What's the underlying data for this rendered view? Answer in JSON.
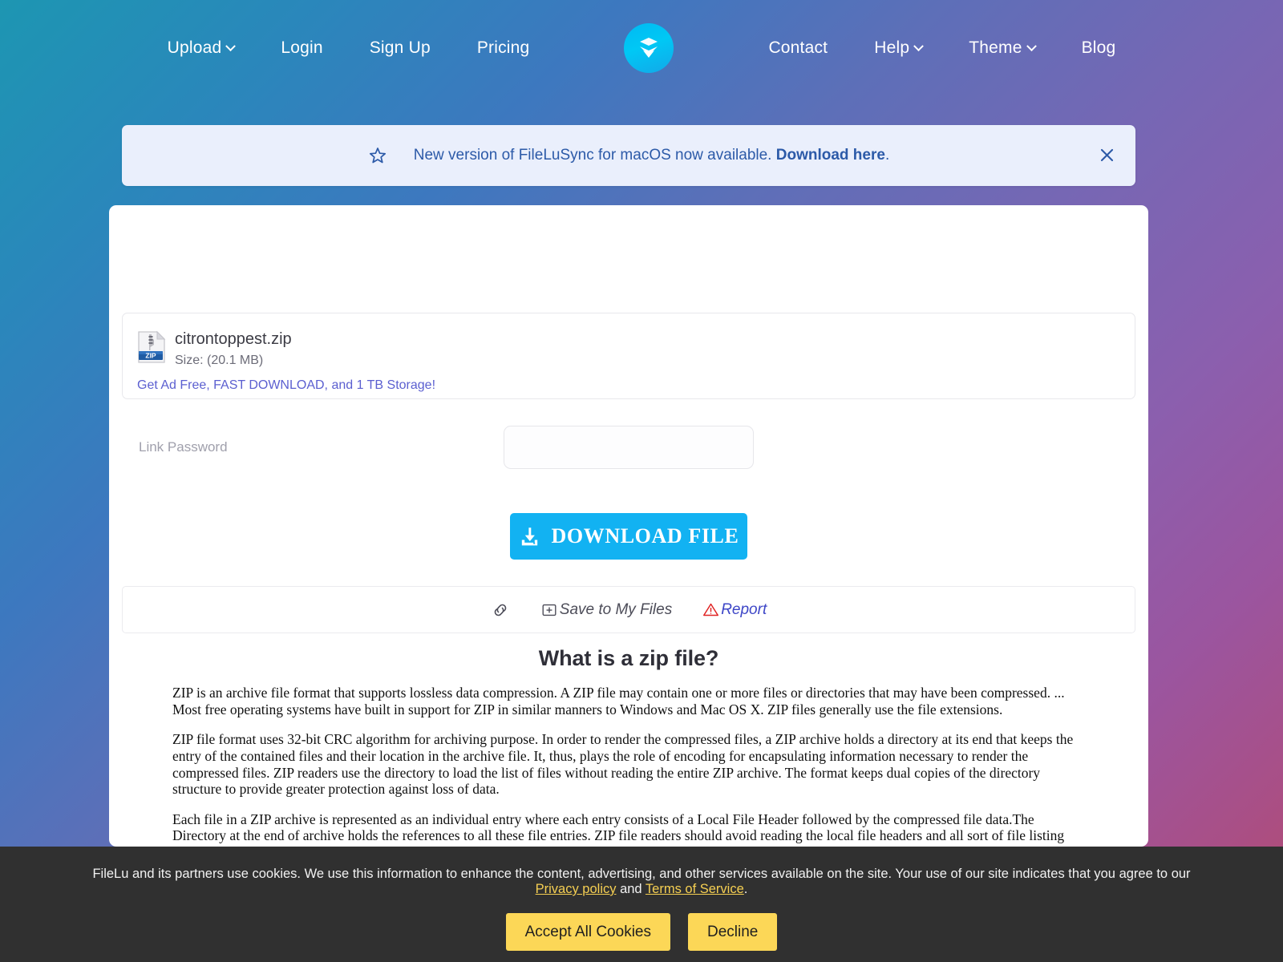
{
  "nav": {
    "left_items": [
      {
        "label": "Upload",
        "has_caret": true
      },
      {
        "label": "Login",
        "has_caret": false
      },
      {
        "label": "Sign Up",
        "has_caret": false
      },
      {
        "label": "Pricing",
        "has_caret": false
      }
    ],
    "right_items": [
      {
        "label": "Contact",
        "has_caret": false
      },
      {
        "label": "Help",
        "has_caret": true
      },
      {
        "label": "Theme",
        "has_caret": true
      },
      {
        "label": "Blog",
        "has_caret": false
      }
    ],
    "logo_icon": "filelu-logo-icon"
  },
  "announcement": {
    "star_icon": "star-icon",
    "text_before": "New version of FileLuSync for macOS now available. ",
    "link_label": "Download here",
    "text_after": ".",
    "close_icon": "close-icon",
    "background_color": "#eaeffc",
    "text_color": "#2c5aa8"
  },
  "file": {
    "icon": "zip-file-icon",
    "name": "citrontoppest.zip",
    "size_label": "Size: (20.1 MB)",
    "promo_link": "Get Ad Free, FAST DOWNLOAD, and 1 TB Storage!",
    "promo_color": "#5b5fd0"
  },
  "password": {
    "label": "Link Password",
    "value": "",
    "placeholder": ""
  },
  "download": {
    "icon": "download-icon",
    "label": "DOWNLOAD FILE",
    "color": "#12b2f2"
  },
  "actions": [
    {
      "name": "copy-link",
      "icon": "link-icon",
      "label": ""
    },
    {
      "name": "save-to-my-files",
      "icon": "folder-plus-icon",
      "label": "Save to My Files"
    },
    {
      "name": "report",
      "icon": "warning-triangle-icon",
      "label": "Report"
    }
  ],
  "article": {
    "heading": "What is a zip file?",
    "paragraphs": [
      "ZIP is an archive file format that supports lossless data compression. A ZIP file may contain one or more files or directories that may have been compressed. ... Most free operating systems have built in support for ZIP in similar manners to Windows and Mac OS X. ZIP files generally use the file extensions.",
      "ZIP file format uses 32-bit CRC algorithm for archiving purpose. In order to render the compressed files, a ZIP archive holds a directory at its end that keeps the entry of the contained files and their location in the archive file. It, thus, plays the role of encoding for encapsulating information necessary to render the compressed files. ZIP readers use the directory to load the list of files without reading the entire ZIP archive. The format keeps dual copies of the directory structure to provide greater protection against loss of data.",
      "Each file in a ZIP archive is represented as an individual entry where each entry consists of a Local File Header followed by the compressed file data.The Directory at the end of archive holds the references to all these file entries. ZIP file readers should avoid reading the local file headers and all sort of file listing should be read from the Directory. This Directory is the only source for valid file entries in the archive as files can be appended towards the end of the archive as well. That is why if a reader reads local headers of a ZIP archive from the beginning, it may read invalid (deleted) entries as well those are not part of the Directory being deleted from archive."
    ]
  },
  "cookies": {
    "text_1": "FileLu and its partners use cookies. We use this information to enhance the content, advertising, and other services available on the site. Your use of our site indicates that you agree to our ",
    "privacy_label": "Privacy policy",
    "text_2": " and ",
    "terms_label": "Terms of Service",
    "text_3": ".",
    "accept_label": "Accept All Cookies",
    "decline_label": "Decline",
    "button_color": "#fcd757",
    "link_color": "#f5cf52"
  }
}
